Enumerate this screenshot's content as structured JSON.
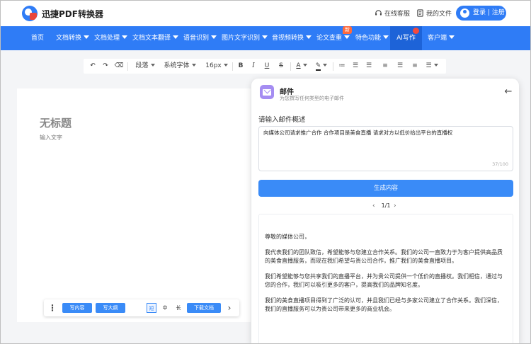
{
  "header": {
    "brand": "迅捷PDF转换器",
    "support_label": "在线客服",
    "my_files_label": "我的文件",
    "login_label": "登录 | 注册"
  },
  "nav": {
    "items": [
      {
        "label": "首页"
      },
      {
        "label": "文档转换"
      },
      {
        "label": "文档处理"
      },
      {
        "label": "文档文本翻译"
      },
      {
        "label": "语音识别"
      },
      {
        "label": "图片文字识别"
      },
      {
        "label": "音视频转换"
      },
      {
        "label": "论文查重"
      },
      {
        "label": "特色功能"
      },
      {
        "label": "AI写作"
      },
      {
        "label": "客户端"
      }
    ],
    "new_badge": "新"
  },
  "toolbar": {
    "paragraph": "段落",
    "font": "系统字体",
    "size": "16px"
  },
  "document": {
    "title": "无标题",
    "hint": "输入文字"
  },
  "doc_bar": {
    "write_content": "写内容",
    "write_outline": "写大纲",
    "length_short": "短",
    "length_medium": "中",
    "length_long": "长",
    "download": "下载文档"
  },
  "panel": {
    "title": "邮件",
    "subtitle": "为您撰写任何类型的电子邮件",
    "prompt_label": "请输入邮件概述",
    "prompt_value": "向媒体公司请求推广合作 合作项目是美食直播 请求对方以低价给出平台的直播权",
    "char_count": "37/100",
    "generate_label": "生成内容",
    "pager": "1/1",
    "result_paragraphs": [
      "尊敬的媒体公司，",
      "我代表我们的团队致信，希望能够与您建立合作关系。我们的公司一直致力于为客户提供高品质的美食直播服务，而现在我们希望与贵公司合作，推广我们的美食直播项目。",
      "我们希望能够与您共享我们的直播平台，并为贵公司提供一个低价的直播权。我们相信，通过与您的合作，我们可以吸引更多的客户，提高我们的品牌知名度。",
      "我们的美食直播项目得到了广泛的认可，并且我们已经与多家公司建立了合作关系。我们深信，我们的直播服务可以为贵公司带来更多的商业机会。"
    ]
  },
  "colors": {
    "brand_blue": "#2f7cf6",
    "nav_active": "#1d63d8",
    "button_blue": "#3a8bf7",
    "badge_orange": "#ff6b3d"
  }
}
